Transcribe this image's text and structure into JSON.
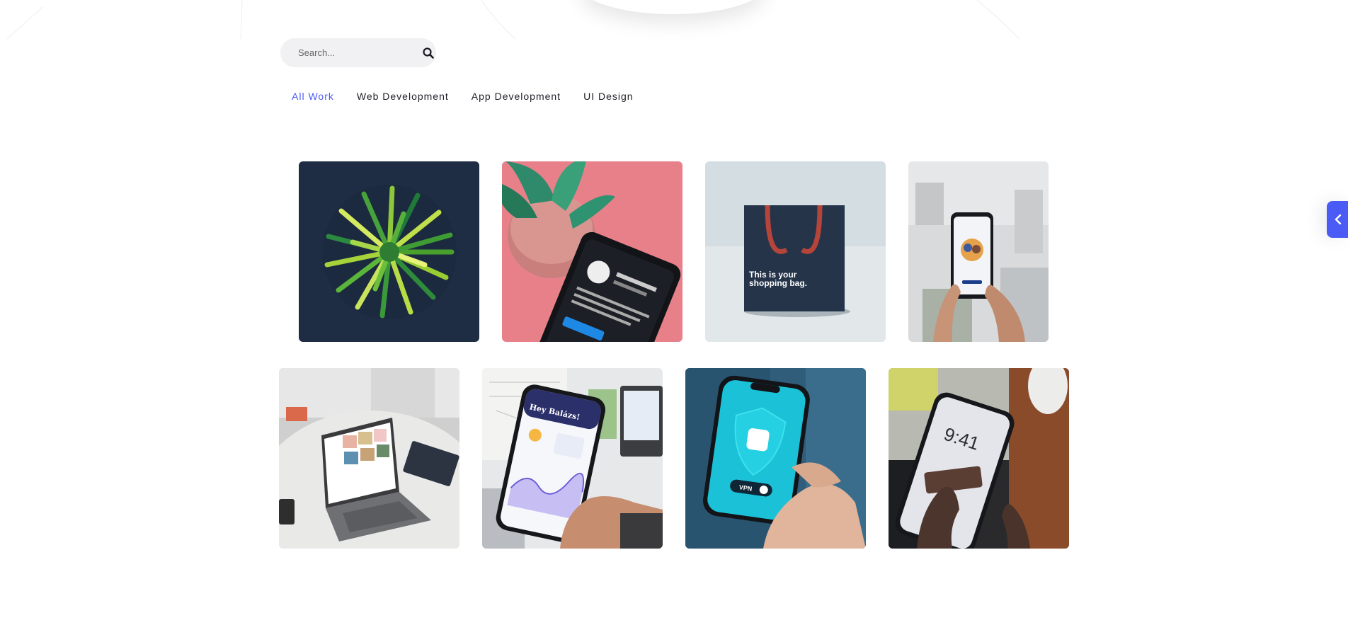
{
  "search": {
    "placeholder": "Search..."
  },
  "filters": [
    {
      "label": "All Work",
      "active": true
    },
    {
      "label": "Web Development",
      "active": false
    },
    {
      "label": "App Development",
      "active": false
    },
    {
      "label": "UI Design",
      "active": false
    }
  ],
  "portfolio": {
    "items": [
      {
        "image": "green-straw-bundle"
      },
      {
        "image": "phone-with-plant-on-pink"
      },
      {
        "image": "shopping-bag-mockup",
        "text_line1": "This is your",
        "text_line2": "shopping bag."
      },
      {
        "image": "hands-holding-phone-building"
      },
      {
        "image": "laptop-on-marble-table"
      },
      {
        "image": "hand-holding-phone-weather-app",
        "screen_text": "Hey Balázs!"
      },
      {
        "image": "hand-holding-phone-vpn",
        "screen_text": "VPN"
      },
      {
        "image": "hands-holding-phone-lockscreen",
        "screen_text": "9:41"
      }
    ]
  },
  "colors": {
    "accent": "#4a5cf5",
    "text": "#1e1e28",
    "search_bg": "#f1f1f3"
  }
}
